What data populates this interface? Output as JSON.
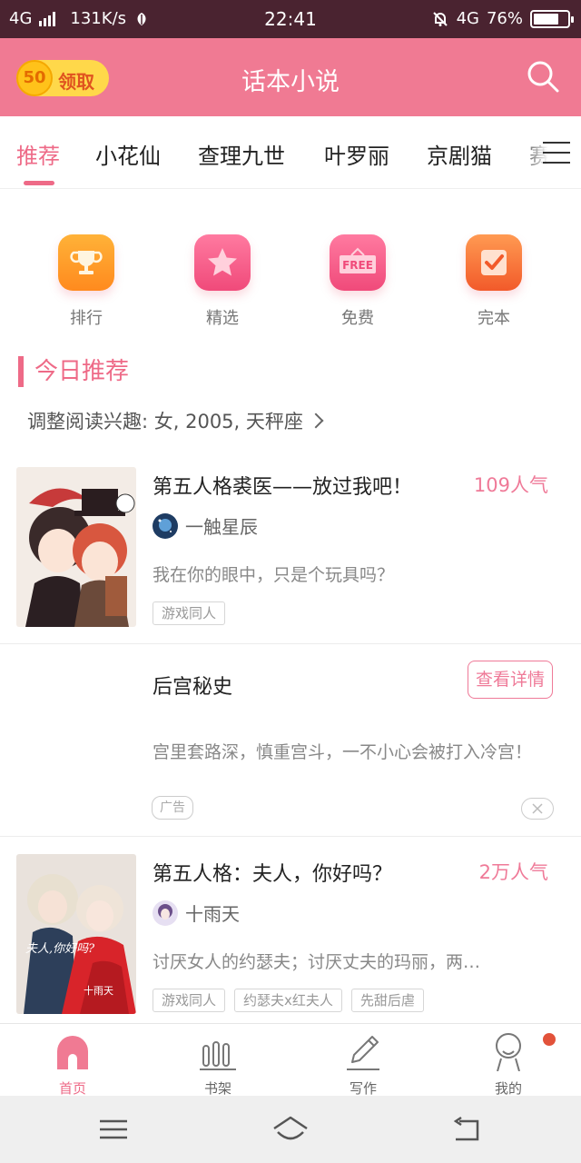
{
  "status_bar": {
    "network": "4G",
    "speed": "131K/s",
    "time": "22:41",
    "network_right": "4G",
    "battery": "76%",
    "battery_level": 0.76
  },
  "header": {
    "coin_count": "50",
    "coin_label": "领取",
    "title": "话本小说",
    "accent_color": "#f07a93"
  },
  "tabs": [
    "推荐",
    "小花仙",
    "查理九世",
    "叶罗丽",
    "京剧猫",
    "赛"
  ],
  "active_tab": "推荐",
  "quick_links": [
    {
      "label": "排行",
      "icon": "trophy-icon"
    },
    {
      "label": "精选",
      "icon": "star-icon"
    },
    {
      "label": "免费",
      "icon": "free-sign-icon",
      "badge_text": "FREE"
    },
    {
      "label": "完本",
      "icon": "checkmark-icon"
    }
  ],
  "section": {
    "title": "今日推荐",
    "interest": "调整阅读兴趣: 女, 2005, 天秤座"
  },
  "books": [
    {
      "title": "第五人格裘医——放过我吧！",
      "popularity": "109人气",
      "author": "一触星辰",
      "description": "我在你的眼中，只是个玩具吗？",
      "tags": [
        "游戏同人"
      ]
    },
    {
      "title": "第五人格：夫人，你好吗？",
      "popularity": "2万人气",
      "author": "十雨天",
      "description": "讨厌女人的约瑟夫；讨厌丈夫的玛丽，两…",
      "tags": [
        "游戏同人",
        "约瑟夫x红夫人",
        "先甜后虐"
      ],
      "cover_text": "十雨天"
    }
  ],
  "ad": {
    "title": "后宫秘史",
    "button": "查看详情",
    "description": "宫里套路深，慎重宫斗，一不小心会被打入冷宫！",
    "badge": "广告"
  },
  "bottom_nav": [
    {
      "label": "首页",
      "icon": "home-icon",
      "active": true
    },
    {
      "label": "书架",
      "icon": "bookshelf-icon",
      "active": false
    },
    {
      "label": "写作",
      "icon": "pencil-icon",
      "active": false
    },
    {
      "label": "我的",
      "icon": "profile-icon",
      "active": false,
      "notification_dot": true
    }
  ]
}
